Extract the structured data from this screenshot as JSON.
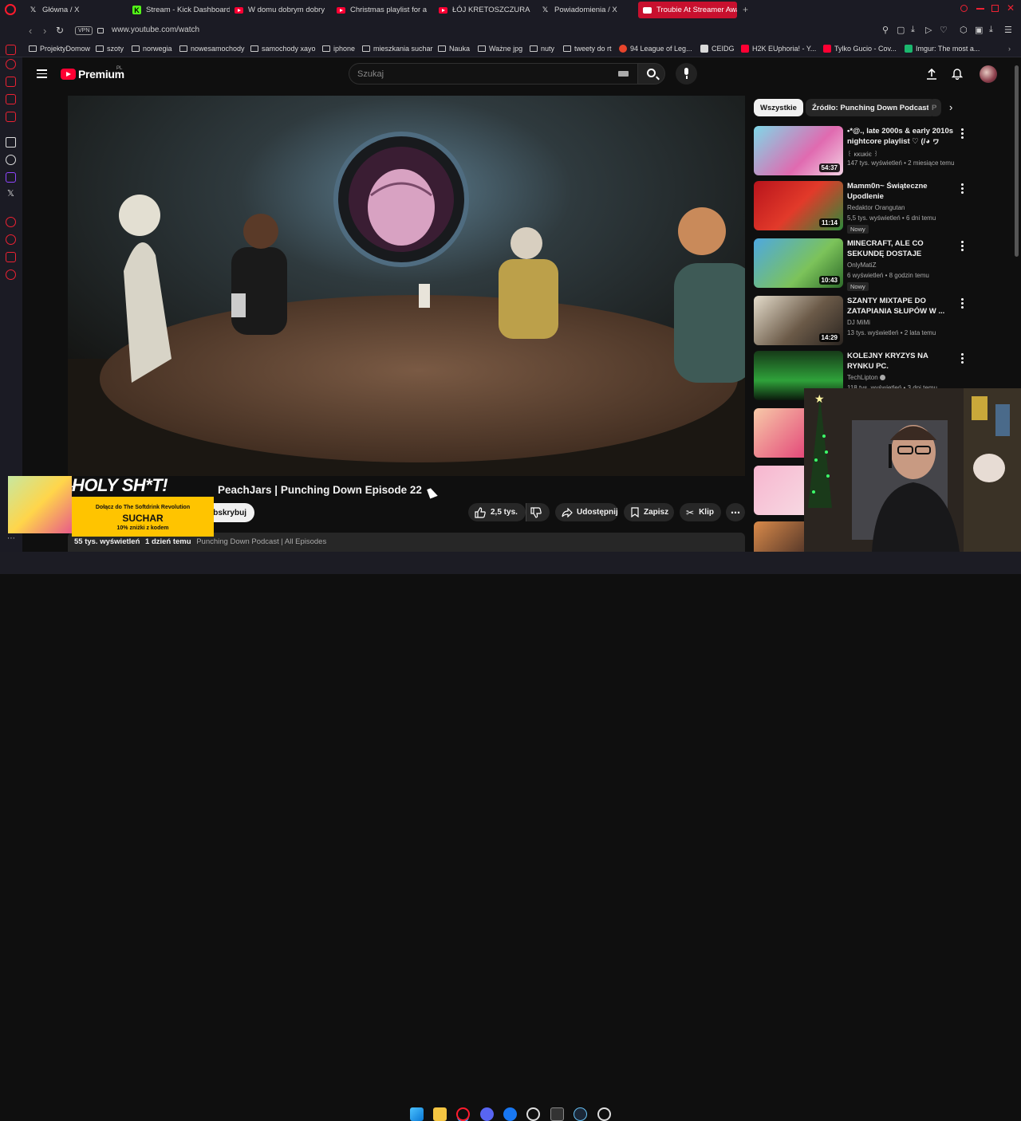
{
  "browser": {
    "tabs": [
      {
        "label": "Główna / X",
        "icon": "x-logo-icon"
      },
      {
        "label": "Stream - Kick Dashboard",
        "icon": "kick-logo-icon"
      },
      {
        "label": "W domu dobrym dobry ś",
        "icon": "youtube-icon"
      },
      {
        "label": "Christmas playlist for a co",
        "icon": "youtube-icon"
      },
      {
        "label": "ŁÓJ KRETOSZCZURA - sa",
        "icon": "youtube-icon"
      },
      {
        "label": "Powiadomienia / X",
        "icon": "x-logo-icon"
      },
      {
        "label": "Troubie At Streamer Awar",
        "icon": "youtube-icon"
      }
    ],
    "new_tab": "+",
    "vpn_label": "VPN",
    "url": "www.youtube.com/watch",
    "bookmarks": [
      {
        "label": "ProjektyDomow",
        "type": "folder"
      },
      {
        "label": "szoty",
        "type": "folder"
      },
      {
        "label": "norwegia",
        "type": "folder"
      },
      {
        "label": "nowesamochody",
        "type": "folder"
      },
      {
        "label": "samochody xayo",
        "type": "folder"
      },
      {
        "label": "iphone",
        "type": "folder"
      },
      {
        "label": "mieszkania suchar",
        "type": "folder"
      },
      {
        "label": "Nauka",
        "type": "folder"
      },
      {
        "label": "Ważne jpg",
        "type": "folder"
      },
      {
        "label": "nuty",
        "type": "folder"
      },
      {
        "label": "tweety do rt",
        "type": "folder"
      },
      {
        "label": "94 League of Leg...",
        "type": "site"
      },
      {
        "label": "CEIDG",
        "type": "site"
      },
      {
        "label": "H2K EUphoria! - Y...",
        "type": "site"
      },
      {
        "label": "Tylko Gucio - Cov...",
        "type": "site"
      },
      {
        "label": "Imgur: The most a...",
        "type": "site"
      }
    ]
  },
  "youtube": {
    "logo_text": "Premium",
    "logo_region": "PL",
    "search_placeholder": "Szukaj",
    "video_title_prefix": "T",
    "video_title": "PeachJars | Punching Down Episode 22",
    "subscribe_label": "ubskrybuj",
    "actions": {
      "likes": "2,5 tys.",
      "share": "Udostępnij",
      "save": "Zapisz",
      "clip": "Klip"
    },
    "meta": {
      "views": "55 tys. wyświetleń",
      "date": "1 dzień temu",
      "links": "Punching Down Podcast | All Episodes"
    },
    "chips": {
      "all": "Wszystkie",
      "source": "Źródło: Punching Down Podcast",
      "more": "P"
    },
    "recommendations": [
      {
        "title": "•*@., late 2000s & early 2010s nightcore playlist ♡ (/◕ ヮ◕)/...",
        "channel": "꒰ ĸĸuĸiє ꒱",
        "views": "147 tys. wyświetleń • 2 miesiące temu",
        "duration": "54:37",
        "badge": ""
      },
      {
        "title": "Mamm0n~ Świąteczne Upodlenie",
        "channel": "Redaktor Orangutan",
        "views": "5,5 tys. wyświetleń • 6 dni temu",
        "duration": "11:14",
        "badge": "Nowy"
      },
      {
        "title": "MINECRAFT, ALE CO SEKUNDĘ DOSTAJE LOSOWE ENCHANT...",
        "channel": "OnlyMatiZ",
        "views": "6 wyświetleń • 8 godzin temu",
        "duration": "10:43",
        "badge": "Nowy"
      },
      {
        "title": "SZANTY MIXTAPE DO ZATAPIANIA SŁUPÓW W ...",
        "channel": "DJ MiMi",
        "views": "13 tys. wyświetleń • 2 lata temu",
        "duration": "14:29",
        "badge": ""
      },
      {
        "title": "KOLEJNY KRYZYS NA RYNKU PC.",
        "channel": "TechLipton",
        "views": "118 tys. wyświetleń • 3 dni temu",
        "duration": "",
        "badge": ""
      }
    ]
  },
  "overlay": {
    "promo_title": "HOLY SH*T!",
    "promo_line1": "Dołącz do The Softdrink Revolution",
    "promo_brand": "SUCHAR",
    "promo_line2": "10% zniżki z kodem"
  },
  "colors": {
    "youtube_red": "#ff0033",
    "active_tab": "#c8102e",
    "opera_red": "#ff1b2d",
    "promo_yellow": "#ffc400"
  }
}
